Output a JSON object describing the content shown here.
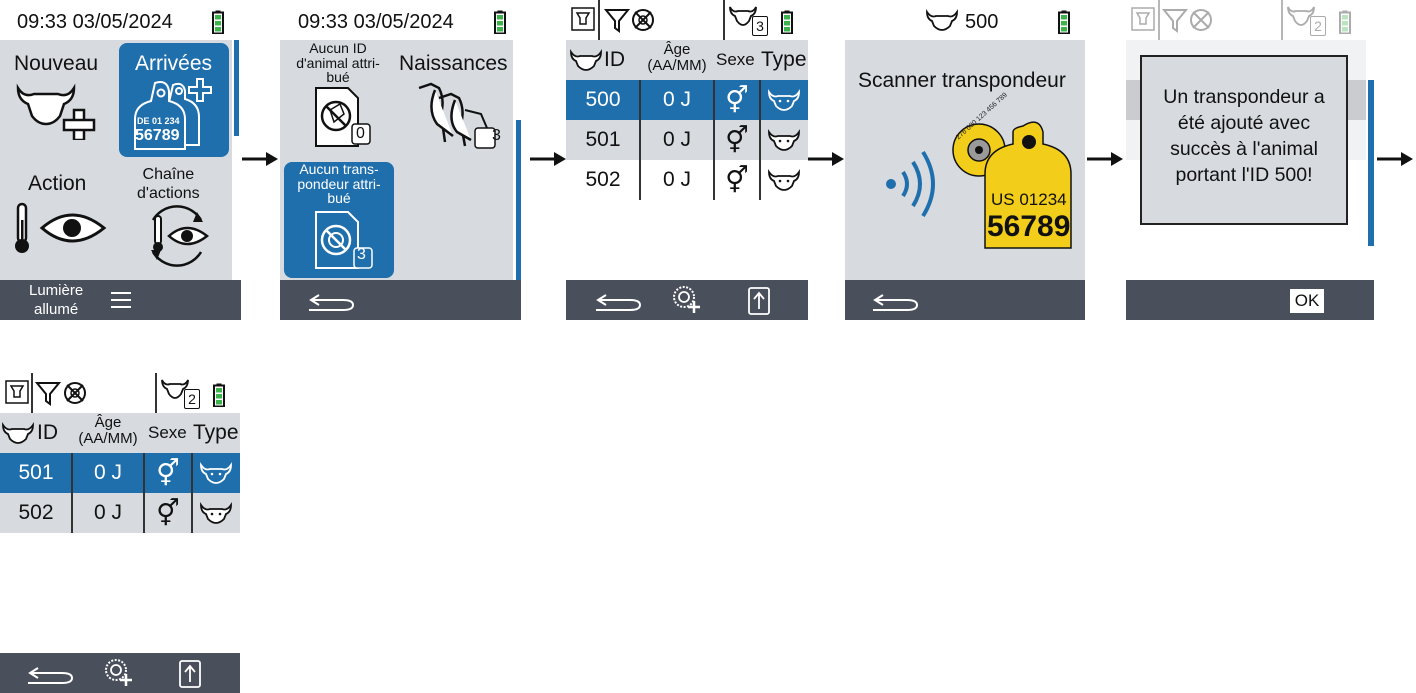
{
  "colors": {
    "accent": "#1f6fad",
    "panel": "#d7dbe0",
    "bar": "#4a4f5c",
    "battery": "#3cb44b",
    "tag": "#f2cd1a"
  },
  "screen1": {
    "time": "09:33 03/05/2024",
    "tiles": {
      "new": "Nouveau",
      "arrivals": "Arrivées",
      "action": "Action",
      "chain": "Chaîne\nd'actions"
    },
    "tag_text": {
      "country": "DE 01 234",
      "number": "56789"
    },
    "bottom": {
      "light": "Lumière\nallumé",
      "menu_icon": "menu-icon"
    }
  },
  "screen2": {
    "time": "09:33 03/05/2024",
    "tiles": {
      "no_id": "Aucun ID\nd'animal attri-\nbué",
      "births": "Naissances",
      "no_transponder": "Aucun trans-\npondeur attri-\nbué"
    },
    "badges": {
      "no_id": "0",
      "births": "3",
      "no_transponder": "3"
    },
    "bottom": {
      "back_icon": "back-icon"
    }
  },
  "screen3": {
    "count": "3",
    "headers": {
      "id": "ID",
      "age": "Âge\n(AA/MM)",
      "sex": "Sexe",
      "type": "Type"
    },
    "rows": [
      {
        "id": "500",
        "age": "0 J"
      },
      {
        "id": "501",
        "age": "0 J"
      },
      {
        "id": "502",
        "age": "0 J"
      }
    ]
  },
  "screen4": {
    "id": "500",
    "title": "Scanner transpondeur",
    "tag": {
      "ring": "276 000 123 456 789",
      "country": "US 01234",
      "number": "56789"
    }
  },
  "screen5": {
    "count": "2",
    "message": "Un transpondeur a\nété ajouté avec\nsuccès à l'animal\nportant l'ID 500!",
    "ok": "OK"
  },
  "screen6": {
    "count": "2",
    "headers": {
      "id": "ID",
      "age": "Âge\n(AA/MM)",
      "sex": "Sexe",
      "type": "Type"
    },
    "rows": [
      {
        "id": "501",
        "age": "0 J"
      },
      {
        "id": "502",
        "age": "0 J"
      }
    ]
  }
}
